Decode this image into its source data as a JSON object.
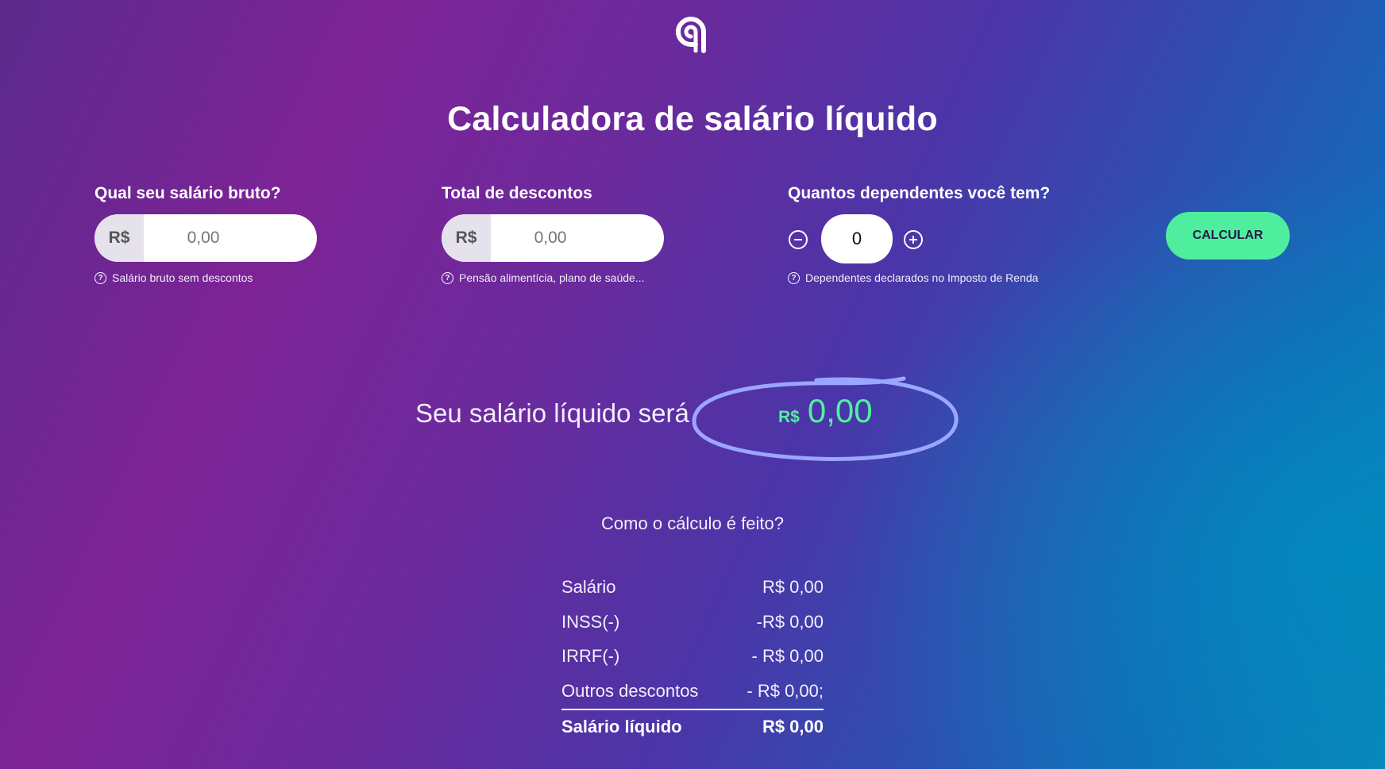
{
  "header": {
    "logo_icon": "brand-logo-icon",
    "title": "Calculadora de salário líquido"
  },
  "fields": {
    "gross": {
      "label": "Qual seu salário bruto?",
      "prefix": "R$",
      "placeholder": "0,00",
      "value": "",
      "hint": "Salário bruto sem descontos"
    },
    "discounts": {
      "label": "Total de descontos",
      "prefix": "R$",
      "placeholder": "0,00",
      "value": "",
      "hint": "Pensão alimentícia, plano de saúde..."
    },
    "dependents": {
      "label": "Quantos dependentes você tem?",
      "value": "0",
      "hint": "Dependentes declarados no Imposto de Renda",
      "minus_icon": "minus-circle-icon",
      "plus_icon": "plus-circle-icon"
    },
    "hint_icon": "question-circle-icon"
  },
  "calculate_button": {
    "label": "CALCULAR"
  },
  "result": {
    "label": "Seu salário líquido será",
    "currency": "R$",
    "value": "0,00"
  },
  "how_title": "Como o cálculo é feito?",
  "breakdown": [
    {
      "label": "Salário",
      "value": "R$ 0,00"
    },
    {
      "label": "INSS(-)",
      "value": "-R$ 0,00"
    },
    {
      "label": "IRRF(-)",
      "value": "- R$ 0,00"
    },
    {
      "label": "Outros descontos",
      "value": "- R$ 0,00;"
    }
  ],
  "total": {
    "label": "Salário líquido",
    "value": "R$ 0,00"
  },
  "colors": {
    "accent_green": "#4fee9e",
    "result_green": "#52ef9f",
    "ellipse_stroke": "#9aa6ff"
  }
}
